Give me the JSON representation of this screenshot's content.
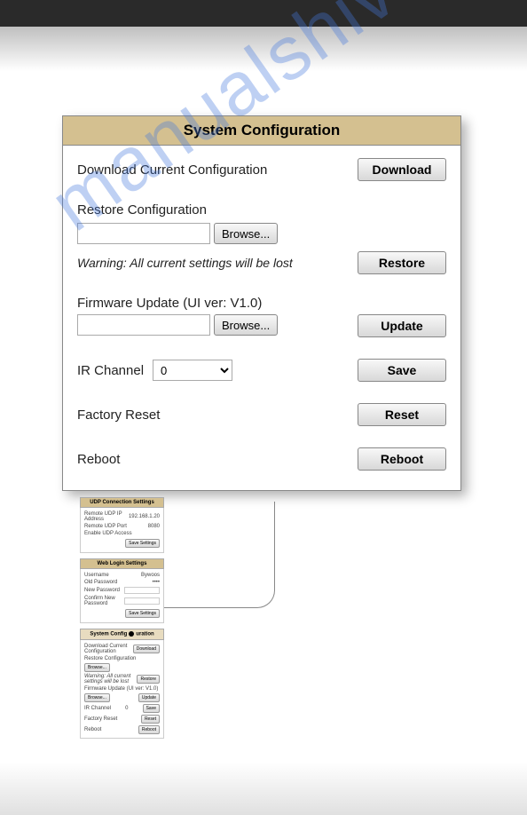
{
  "watermark": "manualshive.com",
  "panel": {
    "title": "System Configuration",
    "download": {
      "label": "Download Current Configuration",
      "button": "Download"
    },
    "restore": {
      "label": "Restore Configuration",
      "browse": "Browse...",
      "file_value": "",
      "warning": "Warning: All current settings will be lost",
      "button": "Restore"
    },
    "firmware": {
      "label": "Firmware Update (UI ver: V1.0)",
      "browse": "Browse...",
      "file_value": "",
      "button": "Update"
    },
    "ir": {
      "label": "IR Channel",
      "value": "0",
      "button": "Save"
    },
    "factory": {
      "label": "Factory Reset",
      "button": "Reset"
    },
    "reboot": {
      "label": "Reboot",
      "button": "Reboot"
    }
  },
  "thumb": {
    "udp": {
      "title": "UDP Connection Settings",
      "row1_label": "Remote UDP IP Address",
      "row1_value": "192.168.1.20",
      "row2_label": "Remote UDP Port",
      "row2_value": "8080",
      "row3_label": "Enable UDP Access",
      "save": "Save Settings"
    },
    "web": {
      "title": "Web Login Settings",
      "row1_label": "Username",
      "row1_value": "Bywoos",
      "row2_label": "Old Password",
      "row2_value": "••••",
      "row3_label": "New Password",
      "row4_label": "Confirm New Password",
      "save": "Save Settings"
    },
    "sys": {
      "title_a": "System Config",
      "title_b": "uration",
      "download_label": "Download Current Configuration",
      "download_btn": "Download",
      "restore_label": "Restore Configuration",
      "browse": "Browse...",
      "warning": "Warning: All current settings will be lost",
      "restore_btn": "Restore",
      "firmware_label": "Firmware Update (UI ver: V1.0)",
      "update_btn": "Update",
      "ir_label": "IR Channel",
      "ir_value": "0",
      "save_btn": "Save",
      "factory_label": "Factory Reset",
      "reset_btn": "Reset",
      "reboot_label": "Reboot",
      "reboot_btn": "Reboot"
    }
  }
}
